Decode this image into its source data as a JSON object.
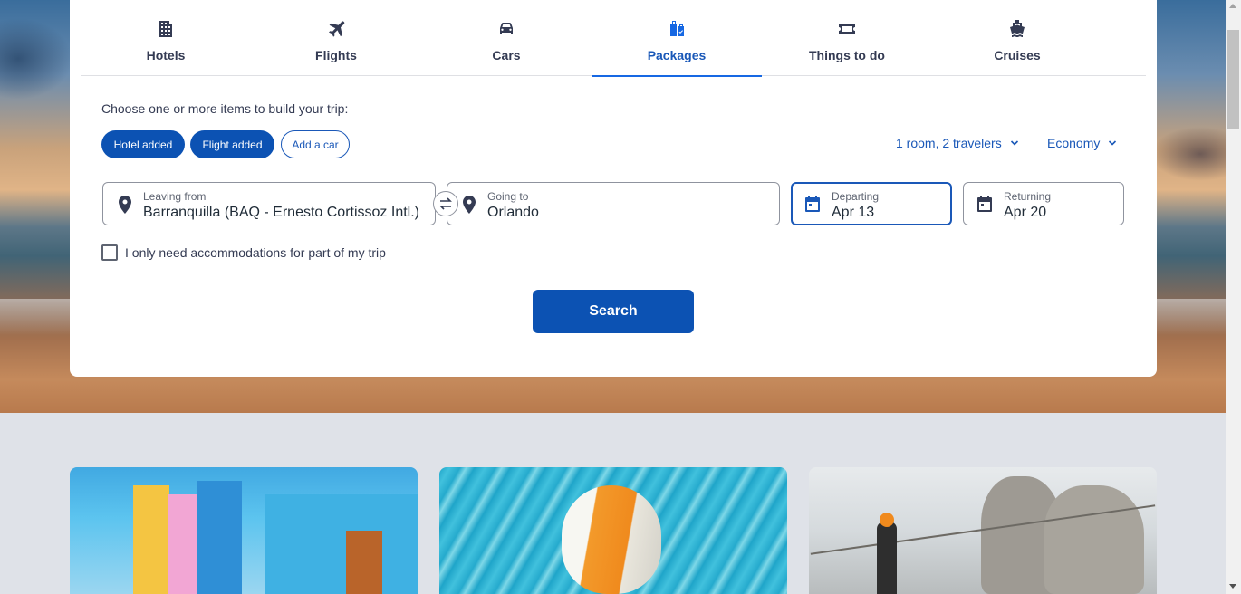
{
  "tabs": [
    {
      "label": "Hotels",
      "icon": "hotel-building-icon",
      "active": false
    },
    {
      "label": "Flights",
      "icon": "airplane-icon",
      "active": false
    },
    {
      "label": "Cars",
      "icon": "car-icon",
      "active": false
    },
    {
      "label": "Packages",
      "icon": "suitcase-icon",
      "active": true
    },
    {
      "label": "Things to do",
      "icon": "ticket-icon",
      "active": false
    },
    {
      "label": "Cruises",
      "icon": "cruise-ship-icon",
      "active": false
    }
  ],
  "form": {
    "intro": "Choose one or more items to build your trip:",
    "chips": [
      {
        "label": "Hotel added",
        "selected": true
      },
      {
        "label": "Flight added",
        "selected": true
      },
      {
        "label": "Add a car",
        "selected": false
      }
    ],
    "travelers": "1 room, 2 travelers",
    "cabin_class": "Economy",
    "leaving": {
      "label": "Leaving from",
      "value": "Barranquilla (BAQ - Ernesto Cortissoz Intl.)"
    },
    "going": {
      "label": "Going to",
      "value": "Orlando"
    },
    "departing": {
      "label": "Departing",
      "value": "Apr 13"
    },
    "returning": {
      "label": "Returning",
      "value": "Apr 20"
    },
    "partial_stay_label": "I only need accommodations for part of my trip",
    "partial_stay_checked": false,
    "search_label": "Search"
  },
  "colors": {
    "accent": "#1668e3",
    "button": "#0c52b3",
    "text": "#343b53"
  }
}
